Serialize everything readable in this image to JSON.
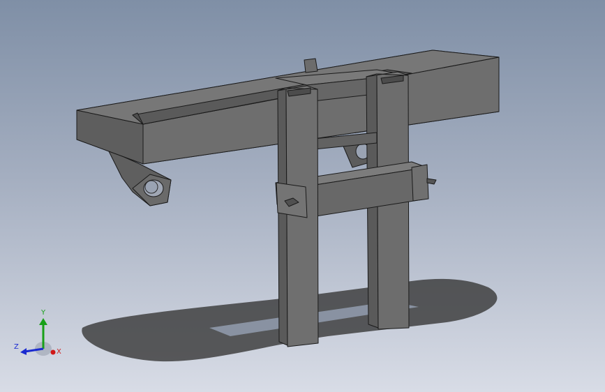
{
  "viewport": {
    "background_top": "#7f8fa6",
    "background_bottom": "#d8dce6"
  },
  "model": {
    "face_color": "#707070",
    "edge_color": "#1a1a1a",
    "shadow_color": "#3a3a3a"
  },
  "triad": {
    "y_label": "Y",
    "z_label": "Z",
    "x_label": "X",
    "y_color": "#18a018",
    "z_color": "#1a2ad0",
    "x_color": "#d01818"
  }
}
